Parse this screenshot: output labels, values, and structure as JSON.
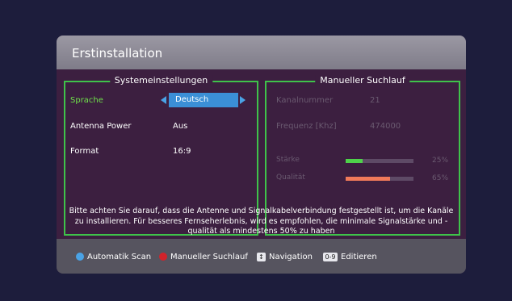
{
  "dialog": {
    "title": "Erstinstallation",
    "info_text": "Bitte achten Sie darauf, dass die Antenne und Signalkabelverbindung festgestellt ist, um die Kanäle zu installieren. Für besseres Fernseherlebnis, wird es empfohlen, die minimale Signalstärke und -qualität als mindestens 50% zu haben"
  },
  "system_settings": {
    "heading": "Systemeinstellungen",
    "language_label": "Sprache",
    "language_value": "Deutsch",
    "antenna_label": "Antenna Power",
    "antenna_value": "Aus",
    "format_label": "Format",
    "format_value": "16:9"
  },
  "manual_scan": {
    "heading": "Manueller Suchlauf",
    "channel_label": "Kanalnummer",
    "channel_value": "21",
    "frequency_label": "Frequenz [Khz]",
    "frequency_value": "474000",
    "strength_label": "Stärke",
    "strength_percent": 25,
    "strength_text": "25%",
    "quality_label": "Qualität",
    "quality_percent": 65,
    "quality_text": "65%"
  },
  "footer": {
    "auto_scan": "Automatik Scan",
    "manual_scan": "Manueller Suchlauf",
    "navigation": "Navigation",
    "edit": "Editieren",
    "edit_key": "0-9"
  },
  "colors": {
    "green": "#3fc24a",
    "selected_text": "#6fe14a",
    "blue_button": "#4aa3e6",
    "red_button": "#d2232a",
    "strength_bar": "#4ed24a",
    "quality_bar": "#f07a5a"
  },
  "icons": {
    "auto_scan": "blue-circle-icon",
    "manual_scan": "red-circle-icon",
    "navigation": "updown-arrow-icon",
    "edit": "number-keys-icon"
  }
}
